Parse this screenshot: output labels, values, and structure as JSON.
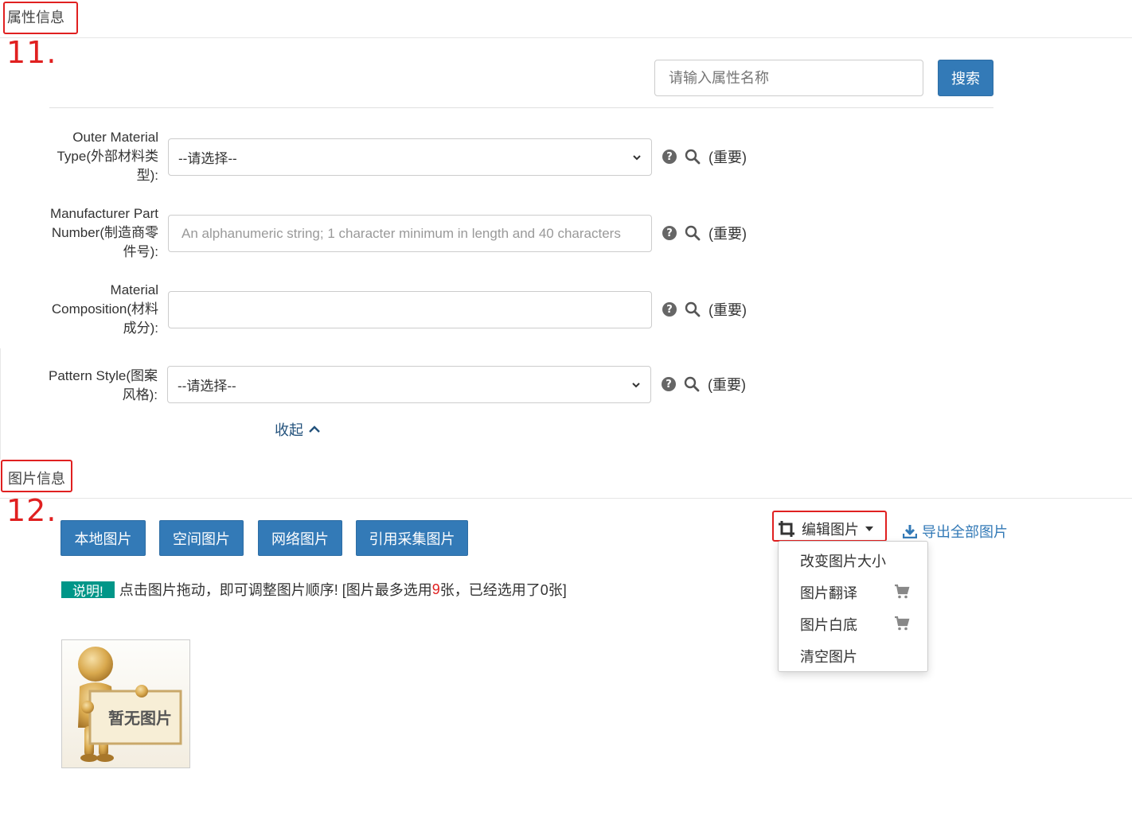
{
  "attr_section": {
    "title": "属性信息",
    "step": "11.",
    "search_placeholder": "请输入属性名称",
    "search_button": "搜索"
  },
  "fields": [
    {
      "label": "Outer Material Type(外部材料类型):",
      "value": "--请选择--",
      "important": "(重要)"
    },
    {
      "label": "Manufacturer Part Number(制造商零件号):",
      "placeholder": "An alphanumeric string; 1 character minimum in length and 40 characters",
      "important": "(重要)"
    },
    {
      "label": "Material Composition(材料成分):",
      "value": "",
      "important": "(重要)"
    },
    {
      "label": "Pattern Style(图案风格):",
      "value": "--请选择--",
      "important": "(重要)"
    }
  ],
  "collapse_label": "收起",
  "image_section": {
    "title": "图片信息",
    "step": "12.",
    "buttons": [
      "本地图片",
      "空间图片",
      "网络图片",
      "引用采集图片"
    ],
    "note_badge": "说明!",
    "note_text_1": "点击图片拖动，即可调整图片顺序! [图片最多选用",
    "note_max": "9",
    "note_text_2": "张，已经选用了0张]",
    "edit_button": "编辑图片",
    "export_link": "导出全部图片",
    "dropdown_items": [
      "改变图片大小",
      "图片翻译",
      "图片白底",
      "清空图片"
    ],
    "thumbnail_text": "暂无图片"
  },
  "colors": {
    "primary": "#337ab7",
    "annotation_red": "#e02020",
    "note_badge": "#009688"
  }
}
